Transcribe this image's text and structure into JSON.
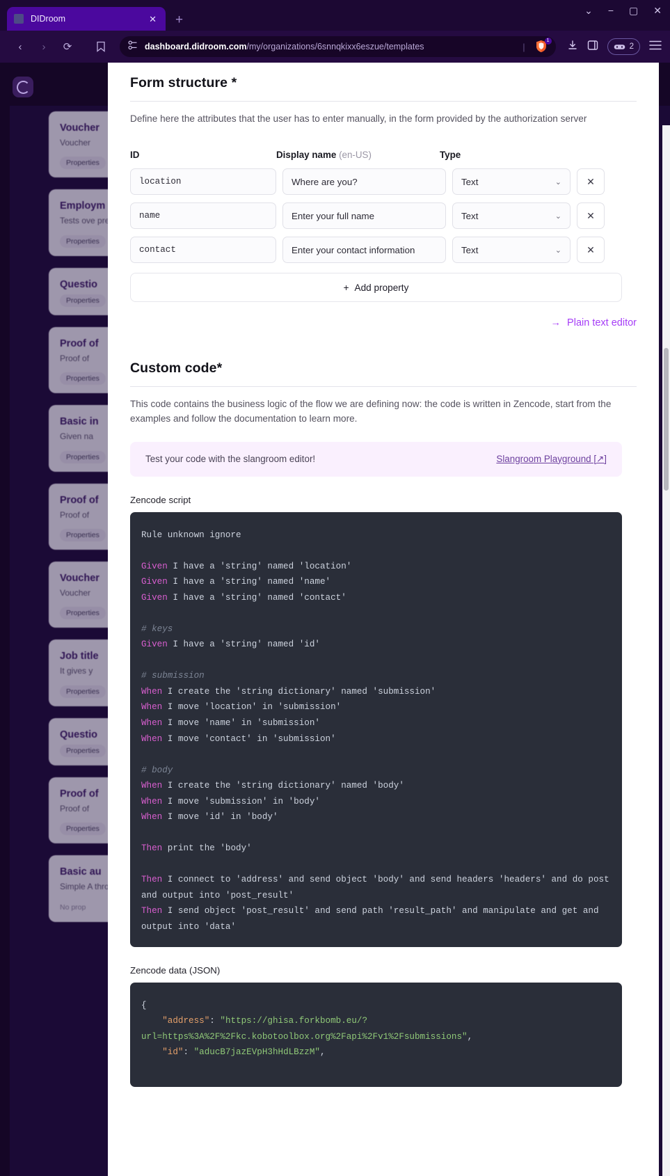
{
  "browser": {
    "tab": {
      "title": "DIDroom",
      "close_label": "✕",
      "favicon": "didroom-favicon"
    },
    "new_tab_label": "+",
    "window_controls": {
      "chevron": "⌄",
      "minimize": "−",
      "maximize": "▢",
      "close": "✕"
    },
    "nav": {
      "back": "‹",
      "forward": "›",
      "reload": "⟳"
    },
    "url": {
      "host": "dashboard.didroom.com",
      "path": "/my/organizations/6snnqkixx6eszue/templates",
      "separator": "|"
    },
    "shield_badge_count": "1",
    "extensions_count": "2"
  },
  "background_app": {
    "cards": [
      {
        "title": "Voucher",
        "desc": "Voucher",
        "chip": "Properties"
      },
      {
        "title": "Employm",
        "desc": "Tests ove\npresent v\npass that",
        "chip": "Properties"
      },
      {
        "title": "Questio",
        "desc": "",
        "chip": "Properties"
      },
      {
        "title": "Proof of",
        "desc": "Proof of",
        "chip": "Properties"
      },
      {
        "title": "Basic in",
        "desc": "Given na",
        "chip": "Properties"
      },
      {
        "title": "Proof of",
        "desc": "Proof of",
        "chip": "Properties"
      },
      {
        "title": "Voucher",
        "desc": "Voucher",
        "chip": "Properties"
      },
      {
        "title": "Job title",
        "desc": "It gives y",
        "chip": "Properties"
      },
      {
        "title": "Questio",
        "desc": "",
        "chip": "Properties"
      },
      {
        "title": "Proof of",
        "desc": "Proof of",
        "chip": "Properties"
      },
      {
        "title": "Basic au",
        "desc": "Simple A\nthrough t\nensures\nagainst u",
        "chip": "No prop"
      }
    ]
  },
  "form_structure": {
    "title": "Form structure *",
    "description": "Define here the attributes that the user has to enter manually, in the form provided by the authorization server",
    "columns": {
      "id": "ID",
      "display_name": "Display name",
      "locale": "(en-US)",
      "type": "Type"
    },
    "rows": [
      {
        "id": "location",
        "display_name": "Where are you?",
        "type": "Text",
        "remove_label": "✕"
      },
      {
        "id": "name",
        "display_name": "Enter your full name",
        "type": "Text",
        "remove_label": "✕"
      },
      {
        "id": "contact",
        "display_name": "Enter your contact information",
        "type": "Text",
        "remove_label": "✕"
      }
    ],
    "add_property_label": "Add property",
    "add_property_icon": "+",
    "plain_text_editor_label": "Plain text editor",
    "plain_text_editor_icon": "→"
  },
  "custom_code": {
    "title": "Custom code*",
    "description": "This code contains the business logic of the flow we are defining now: the code is written in Zencode, start from the examples and follow the documentation to learn more.",
    "banner": {
      "message": "Test your code with the slangroom editor!",
      "link_label": "Slangroom Playground [↗]"
    },
    "zencode_script_label": "Zencode script",
    "zencode_data_label": "Zencode data (JSON)",
    "zencode_script_lines": [
      [
        {
          "t": "Rule unknown ignore",
          "c": ""
        }
      ],
      [],
      [
        {
          "t": "Given",
          "c": "kw"
        },
        {
          "t": " I have a 'string' named 'location'",
          "c": ""
        }
      ],
      [
        {
          "t": "Given",
          "c": "kw"
        },
        {
          "t": " I have a 'string' named 'name'",
          "c": ""
        }
      ],
      [
        {
          "t": "Given",
          "c": "kw"
        },
        {
          "t": " I have a 'string' named 'contact'",
          "c": ""
        }
      ],
      [],
      [
        {
          "t": "# keys",
          "c": "cm"
        }
      ],
      [
        {
          "t": "Given",
          "c": "kw"
        },
        {
          "t": " I have a 'string' named 'id'",
          "c": ""
        }
      ],
      [],
      [
        {
          "t": "# submission",
          "c": "cm"
        }
      ],
      [
        {
          "t": "When",
          "c": "kw"
        },
        {
          "t": " I create the 'string dictionary' named 'submission'",
          "c": ""
        }
      ],
      [
        {
          "t": "When",
          "c": "kw"
        },
        {
          "t": " I move 'location' in 'submission'",
          "c": ""
        }
      ],
      [
        {
          "t": "When",
          "c": "kw"
        },
        {
          "t": " I move 'name' in 'submission'",
          "c": ""
        }
      ],
      [
        {
          "t": "When",
          "c": "kw"
        },
        {
          "t": " I move 'contact' in 'submission'",
          "c": ""
        }
      ],
      [],
      [
        {
          "t": "# body",
          "c": "cm"
        }
      ],
      [
        {
          "t": "When",
          "c": "kw"
        },
        {
          "t": " I create the 'string dictionary' named 'body'",
          "c": ""
        }
      ],
      [
        {
          "t": "When",
          "c": "kw"
        },
        {
          "t": " I move 'submission' in 'body'",
          "c": ""
        }
      ],
      [
        {
          "t": "When",
          "c": "kw"
        },
        {
          "t": " I move 'id' in 'body'",
          "c": ""
        }
      ],
      [],
      [
        {
          "t": "Then",
          "c": "kw"
        },
        {
          "t": " print the 'body'",
          "c": ""
        }
      ],
      [],
      [
        {
          "t": "Then",
          "c": "kw"
        },
        {
          "t": " I connect to 'address' and send object 'body' and send headers 'headers' and do post and output into 'post_result'",
          "c": ""
        }
      ],
      [
        {
          "t": "Then",
          "c": "kw"
        },
        {
          "t": " I send object 'post_result' and send path 'result_path' and manipulate and get and output into 'data'",
          "c": ""
        }
      ]
    ],
    "zencode_data_lines": [
      [
        {
          "t": "{",
          "c": "js-pun"
        }
      ],
      [
        {
          "t": "    ",
          "c": "js-pun"
        },
        {
          "t": "\"address\"",
          "c": "js-key"
        },
        {
          "t": ": ",
          "c": "js-pun"
        },
        {
          "t": "\"https://ghisa.forkbomb.eu/?url=https%3A%2F%2Fkc.kobotoolbox.org%2Fapi%2Fv1%2Fsubmissions\"",
          "c": "js-str"
        },
        {
          "t": ",",
          "c": "js-pun"
        }
      ],
      [
        {
          "t": "    ",
          "c": "js-pun"
        },
        {
          "t": "\"id\"",
          "c": "js-key"
        },
        {
          "t": ": ",
          "c": "js-pun"
        },
        {
          "t": "\"aducB7jazEVpH3hHdLBzzM\"",
          "c": "js-str"
        },
        {
          "t": ",",
          "c": "js-pun"
        }
      ]
    ]
  }
}
